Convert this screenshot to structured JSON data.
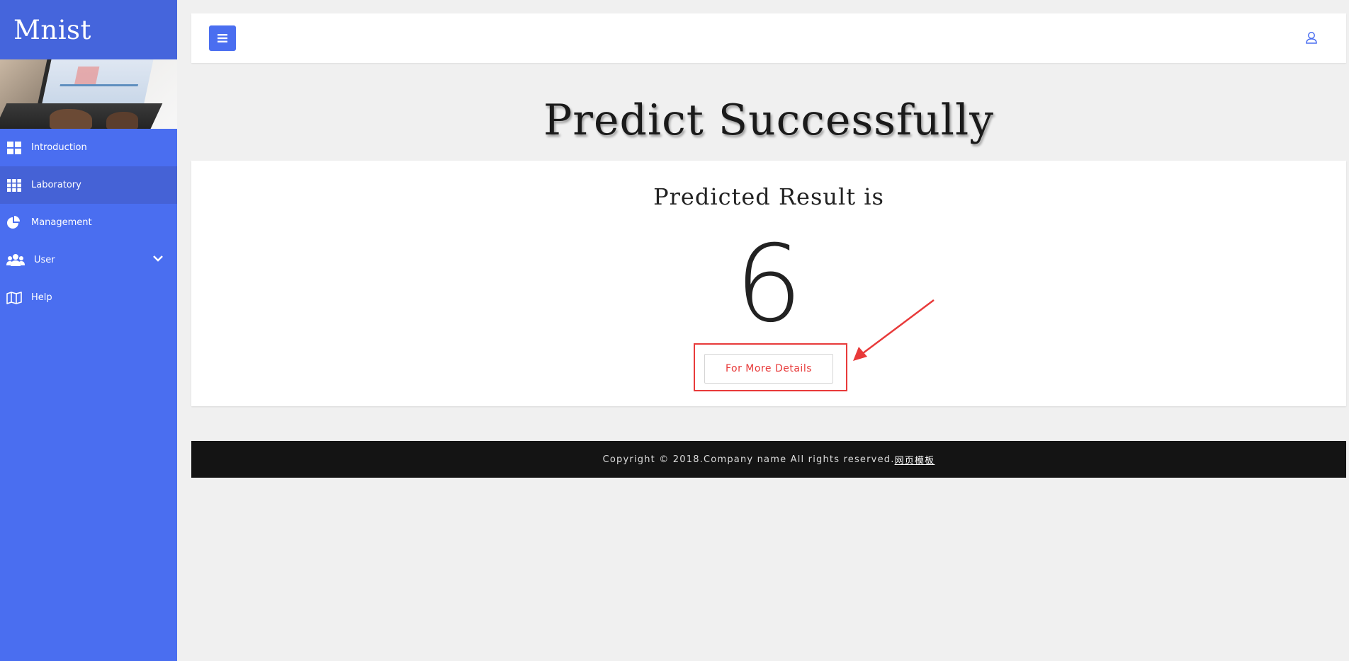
{
  "brand": {
    "title": "Mnist"
  },
  "sidebar": {
    "items": [
      {
        "label": "Introduction",
        "icon": "dashboard-grid-icon",
        "active": false
      },
      {
        "label": "Laboratory",
        "icon": "th-grid-icon",
        "active": true
      },
      {
        "label": "Management",
        "icon": "pie-chart-icon",
        "active": false
      },
      {
        "label": "User",
        "icon": "users-icon",
        "active": false,
        "has_submenu": true
      },
      {
        "label": "Help",
        "icon": "map-icon",
        "active": false
      }
    ]
  },
  "topbar": {
    "menu_icon": "hamburger-icon",
    "user_icon": "user-icon"
  },
  "main": {
    "title": "Predict Successfully",
    "result_heading": "Predicted Result is",
    "result_value": "6",
    "details_button": "For More Details"
  },
  "footer": {
    "copyright": "Copyright © 2018.Company name All rights reserved.",
    "link": "网页模板"
  },
  "colors": {
    "sidebar": "#4a6ef0",
    "brand_bg": "#4565dc",
    "accent_red": "#e83a3a",
    "footer_bg": "#141414",
    "page_bg": "#f0f0f0"
  }
}
